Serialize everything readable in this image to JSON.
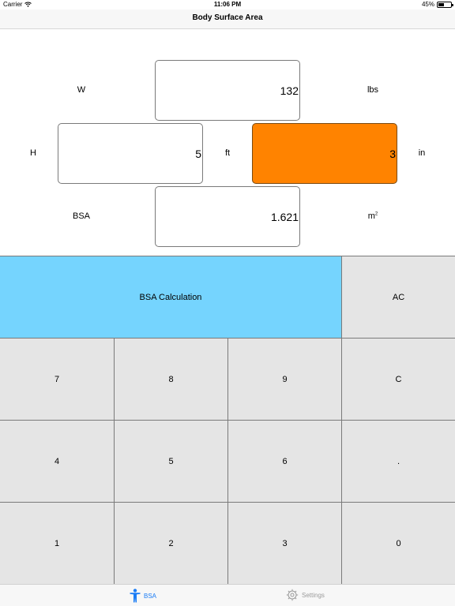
{
  "status_bar": {
    "carrier": "Carrier",
    "time": "11:06 PM",
    "battery": "45%",
    "battery_level": 0.45
  },
  "nav": {
    "title": "Body Surface Area"
  },
  "form": {
    "weight": {
      "label": "W",
      "value": "132",
      "unit": "lbs"
    },
    "height": {
      "label": "H",
      "feet": "5",
      "feet_unit": "ft",
      "inches": "3",
      "inches_unit": "in"
    },
    "bsa": {
      "label": "BSA",
      "value": "1.621",
      "unit": "m",
      "unit_sup": "2"
    }
  },
  "keypad": {
    "calc_label": "BSA Calculation",
    "ac": "AC",
    "k7": "7",
    "k8": "8",
    "k9": "9",
    "clear": "C",
    "k4": "4",
    "k5": "5",
    "k6": "6",
    "dot": ".",
    "k1": "1",
    "k2": "2",
    "k3": "3",
    "k0": "0"
  },
  "tabs": [
    {
      "label": "BSA",
      "icon": "person-icon",
      "selected": true
    },
    {
      "label": "Settings",
      "icon": "gear-icon",
      "selected": false
    }
  ],
  "colors": {
    "active_field": "#ff8300",
    "calc_button": "#75d4fe",
    "key_bg": "#e5e5e5",
    "tab_selected": "#1a7cf5"
  }
}
